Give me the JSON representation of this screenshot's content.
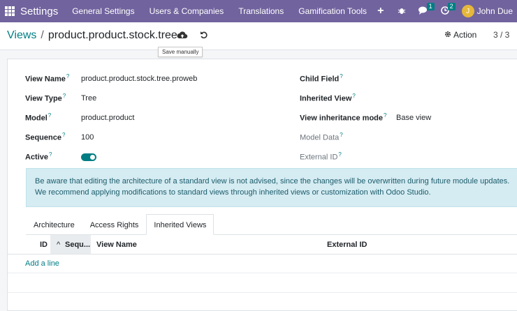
{
  "topbar": {
    "app_name": "Settings",
    "menu": [
      "General Settings",
      "Users & Companies",
      "Translations",
      "Gamification Tools"
    ],
    "plus": "+",
    "messages_badge": "1",
    "activities_badge": "2",
    "avatar_initial": "J",
    "user_name": "John Due"
  },
  "control": {
    "breadcrumb_parent": "Views",
    "breadcrumb_sep": "/",
    "breadcrumb_current": "product.product.stock.tree",
    "save_tooltip": "Save manually",
    "action_label": "Action",
    "pager": "3 / 3"
  },
  "form": {
    "view_name_label": "View Name",
    "view_name_value": "product.product.stock.tree.proweb",
    "view_type_label": "View Type",
    "view_type_value": "Tree",
    "model_label": "Model",
    "model_value": "product.product",
    "sequence_label": "Sequence",
    "sequence_value": "100",
    "active_label": "Active",
    "child_field_label": "Child Field",
    "inherited_view_label": "Inherited View",
    "inheritance_mode_label": "View inheritance mode",
    "inheritance_mode_value": "Base view",
    "model_data_label": "Model Data",
    "external_id_label": "External ID",
    "help_mark": "?"
  },
  "alert": {
    "line1": "Be aware that editing the architecture of a standard view is not advised, since the changes will be overwritten during future module updates.",
    "line2": "We recommend applying modifications to standard views through inherited views or customization with Odoo Studio."
  },
  "tabs": [
    "Architecture",
    "Access Rights",
    "Inherited Views"
  ],
  "table": {
    "col_id": "ID",
    "col_sequence": "Sequ...",
    "col_view_name": "View Name",
    "col_external_id": "External ID",
    "add_line": "Add a line"
  },
  "colors": {
    "brand": "#71639e",
    "accent": "#017e84"
  }
}
